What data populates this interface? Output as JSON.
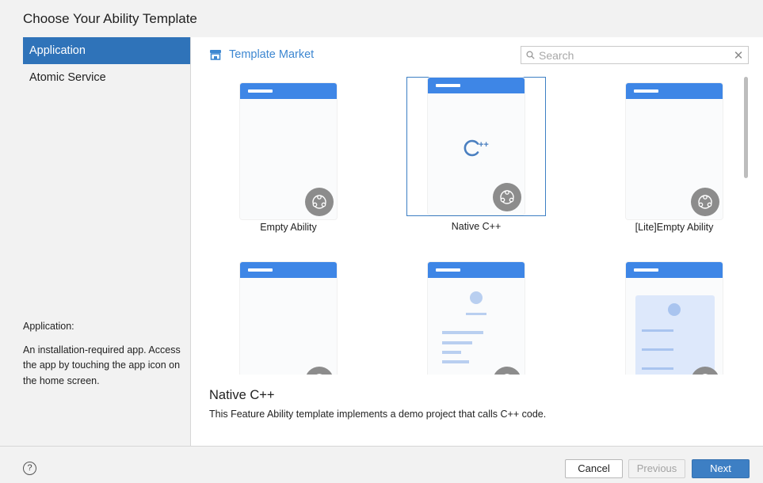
{
  "dialog": {
    "title": "Choose Your Ability Template"
  },
  "sidebar": {
    "items": [
      {
        "label": "Application",
        "active": true
      },
      {
        "label": "Atomic Service",
        "active": false
      }
    ],
    "description_title": "Application:",
    "description": "An installation-required app. Access the app by touching the app icon on the home screen."
  },
  "main": {
    "market_label": "Template Market",
    "search": {
      "placeholder": "Search",
      "value": ""
    },
    "templates": [
      {
        "label": "Empty Ability",
        "selected": false
      },
      {
        "label": "Native C++",
        "selected": true,
        "icon": "cpp-icon",
        "icon_text": "++"
      },
      {
        "label": "[Lite]Empty Ability",
        "selected": false
      },
      {
        "label": "",
        "selected": false
      },
      {
        "label": "",
        "selected": false
      },
      {
        "label": "",
        "selected": false
      }
    ],
    "selected_title": "Native C++",
    "selected_description": "This Feature Ability template implements a demo project that calls C++ code."
  },
  "footer": {
    "help_icon": "?",
    "cancel_label": "Cancel",
    "previous_label": "Previous",
    "next_label": "Next"
  },
  "colors": {
    "accent": "#2f73b9",
    "phone_header": "#3e86e6",
    "badge": "#8c8c8c"
  }
}
